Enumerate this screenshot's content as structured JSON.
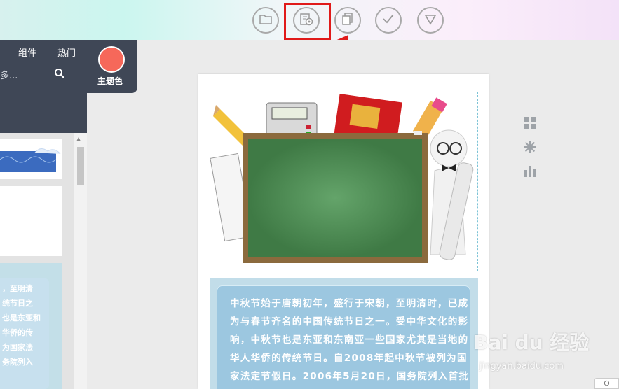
{
  "toolbar": {
    "buttons": [
      {
        "icon": "folder-icon"
      },
      {
        "icon": "preview-icon"
      },
      {
        "icon": "copy-icon"
      },
      {
        "icon": "check-icon"
      },
      {
        "icon": "triangle-down-icon"
      }
    ],
    "highlight_color": "#e01a1a"
  },
  "sidebar": {
    "tabs": [
      "组件",
      "热门"
    ],
    "search_more": "多...",
    "theme_label": "主题色",
    "theme_color": "#f6685a"
  },
  "thumb_preview_text": "，至明清\n统节日之\n也是东亚和\n华侨的传\n为国家法\n务院列入",
  "canvas": {
    "festival_text": "中秋节始于唐朝初年，盛行于宋朝，至明清时，已成为与春节齐名的中国传统节日之一。受中华文化的影响，中秋节也是东亚和东南亚一些国家尤其是当地的华人华侨的传统节日。自2008年起中秋节被列为国家法定节假日。2006年5月20日，国务院列入首批国家级非物"
  },
  "side_icons": [
    "grid-icon",
    "gear-icon",
    "bar-chart-icon"
  ],
  "watermark": {
    "brand": "Bai du 经验",
    "url": "jingyan.baidu.com"
  }
}
